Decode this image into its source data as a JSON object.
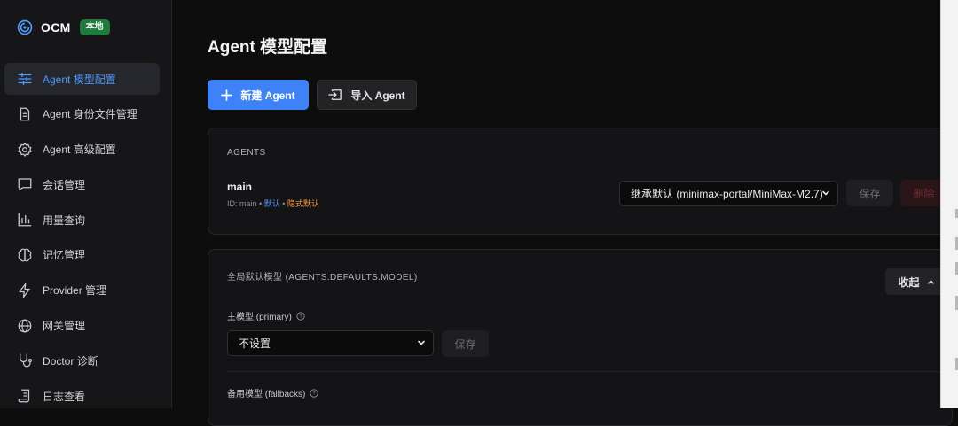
{
  "brand": {
    "name": "OCM",
    "badge": "本地",
    "accent": "#4d9bff"
  },
  "sidebar": {
    "items": [
      {
        "label": "Agent 模型配置",
        "icon": "sliders-icon",
        "active": true
      },
      {
        "label": "Agent 身份文件管理",
        "icon": "file-icon",
        "active": false
      },
      {
        "label": "Agent 高级配置",
        "icon": "gear-icon",
        "active": false
      },
      {
        "label": "会话管理",
        "icon": "chat-icon",
        "active": false
      },
      {
        "label": "用量查询",
        "icon": "bar-chart-icon",
        "active": false
      },
      {
        "label": "记忆管理",
        "icon": "brain-icon",
        "active": false
      },
      {
        "label": "Provider 管理",
        "icon": "lightning-icon",
        "active": false
      },
      {
        "label": "网关管理",
        "icon": "globe-icon",
        "active": false
      },
      {
        "label": "Doctor 诊断",
        "icon": "stethoscope-icon",
        "active": false
      },
      {
        "label": "日志查看",
        "icon": "scroll-icon",
        "active": false
      }
    ]
  },
  "page": {
    "title": "Agent 模型配置",
    "new_agent_label": "新建 Agent",
    "import_agent_label": "导入 Agent"
  },
  "agents_card": {
    "section_title": "AGENTS",
    "agent": {
      "name": "main",
      "id_text": "ID: main",
      "separator": "•",
      "default_tag": "默认",
      "implicit_default_tag": "隐式默认",
      "model_select_value": "继承默认 (minimax-portal/MiniMax-M2.7)",
      "save_label": "保存",
      "delete_label": "删除"
    }
  },
  "defaults_card": {
    "section_title": "全局默认模型 (AGENTS.DEFAULTS.MODEL)",
    "collapse_label": "收起",
    "primary_label": "主模型 (primary)",
    "primary_select_value": "不设置",
    "primary_save_label": "保存",
    "fallbacks_label": "备用模型 (fallbacks)"
  },
  "colors": {
    "primary": "#3d82f6",
    "badge_green": "#1f7a3c",
    "implicit_orange": "#ff9a3c"
  }
}
